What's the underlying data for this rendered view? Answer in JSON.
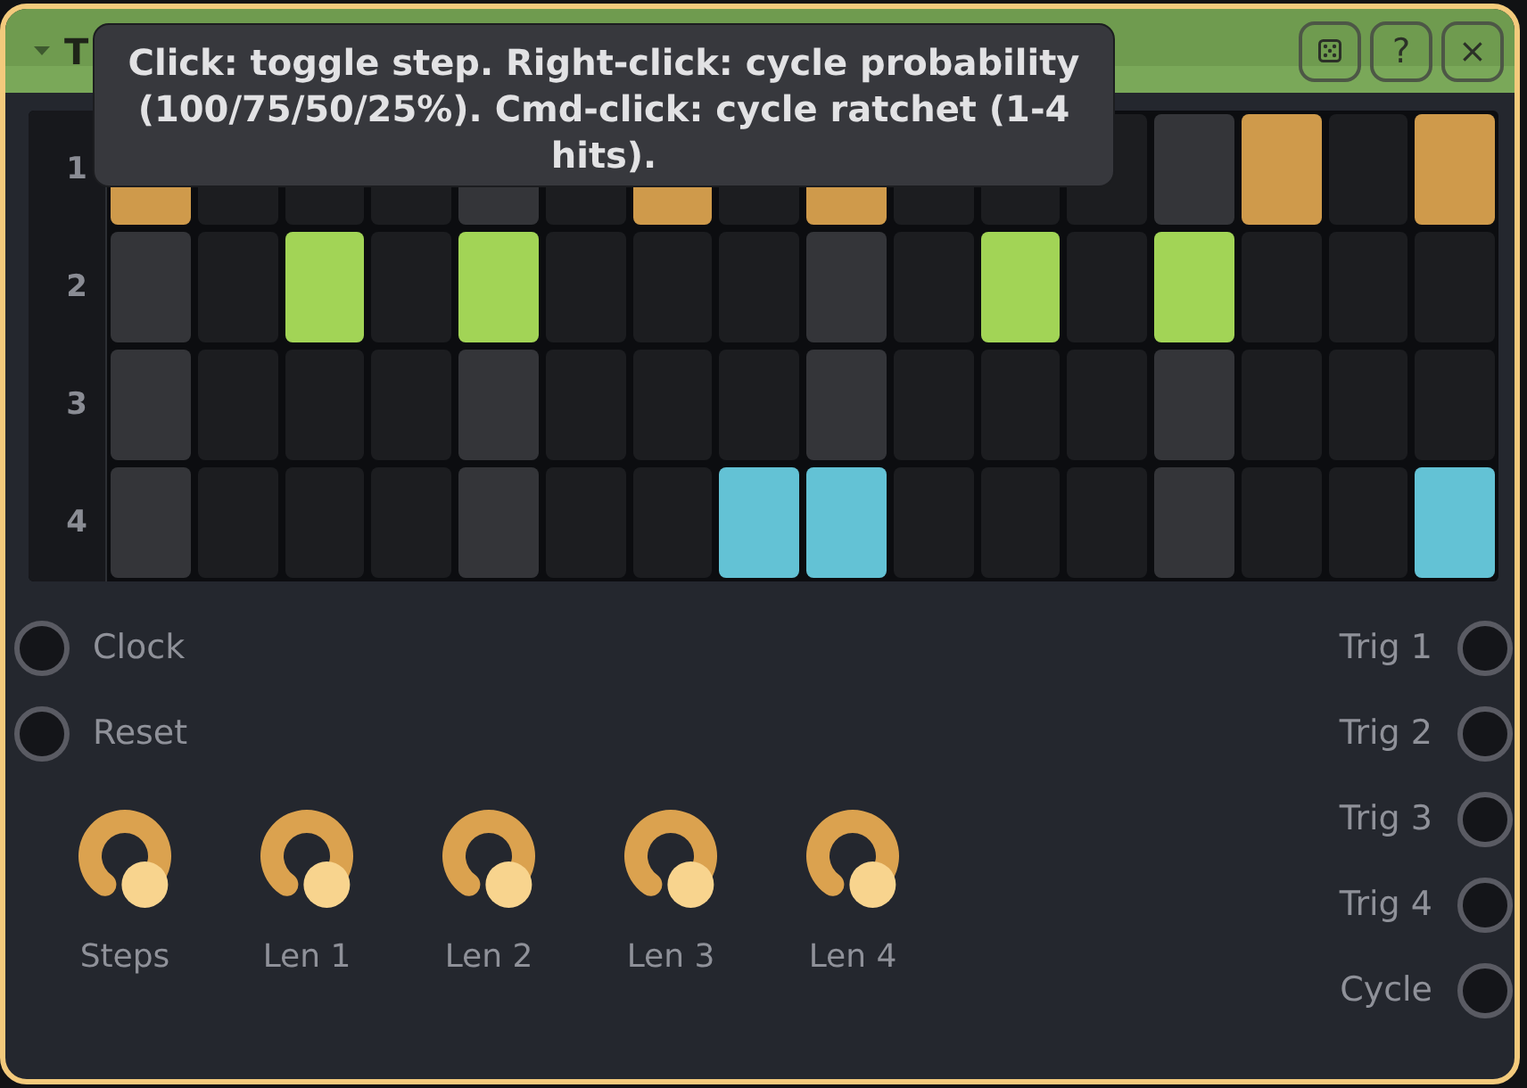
{
  "window": {
    "title": "T",
    "expanded": true,
    "buttons": [
      {
        "kind": "dice"
      },
      {
        "kind": "text",
        "label": "?"
      },
      {
        "kind": "text",
        "label": "×"
      }
    ]
  },
  "tooltip": {
    "text": "Click: toggle step. Right-click: cycle probability (100/75/50/25%). Cmd-click: cycle ratchet (1-4 hits)."
  },
  "grid": {
    "columns": [
      {
        "accent": true
      },
      {
        "accent": false
      },
      {
        "accent": false
      },
      {
        "accent": false
      },
      {
        "accent": true
      },
      {
        "accent": false
      },
      {
        "accent": false
      },
      {
        "accent": false
      },
      {
        "accent": true
      },
      {
        "accent": false
      },
      {
        "accent": false
      },
      {
        "accent": false
      },
      {
        "accent": true
      },
      {
        "accent": false
      },
      {
        "accent": false
      },
      {
        "accent": false
      }
    ],
    "rows": [
      {
        "label": "1",
        "color": "#cf9a4b",
        "steps": [
          {
            "on": true
          },
          {
            "on": false
          },
          {
            "on": false
          },
          {
            "on": false
          },
          {
            "on": false
          },
          {
            "on": false
          },
          {
            "on": true
          },
          {
            "on": false
          },
          {
            "on": true
          },
          {
            "on": false
          },
          {
            "on": false
          },
          {
            "on": false
          },
          {
            "on": false
          },
          {
            "on": true
          },
          {
            "on": false
          },
          {
            "on": true
          }
        ]
      },
      {
        "label": "2",
        "color": "#a2d456",
        "steps": [
          {
            "on": false
          },
          {
            "on": false
          },
          {
            "on": true
          },
          {
            "on": false
          },
          {
            "on": true
          },
          {
            "on": false
          },
          {
            "on": false
          },
          {
            "on": false
          },
          {
            "on": false
          },
          {
            "on": false
          },
          {
            "on": true
          },
          {
            "on": false
          },
          {
            "on": true
          },
          {
            "on": false
          },
          {
            "on": false
          },
          {
            "on": false
          }
        ]
      },
      {
        "label": "3",
        "steps": [
          {
            "on": false
          },
          {
            "on": false
          },
          {
            "on": false
          },
          {
            "on": false
          },
          {
            "on": false
          },
          {
            "on": false
          },
          {
            "on": false
          },
          {
            "on": false
          },
          {
            "on": false
          },
          {
            "on": false
          },
          {
            "on": false
          },
          {
            "on": false
          },
          {
            "on": false
          },
          {
            "on": false
          },
          {
            "on": false
          },
          {
            "on": false
          }
        ]
      },
      {
        "label": "4",
        "color": "#63c2d5",
        "steps": [
          {
            "on": false
          },
          {
            "on": false
          },
          {
            "on": false
          },
          {
            "on": false
          },
          {
            "on": false
          },
          {
            "on": false
          },
          {
            "on": false
          },
          {
            "on": true
          },
          {
            "on": true
          },
          {
            "on": false
          },
          {
            "on": false
          },
          {
            "on": false
          },
          {
            "on": false
          },
          {
            "on": false
          },
          {
            "on": false
          },
          {
            "on": true
          }
        ]
      }
    ]
  },
  "inputs": [
    {
      "label": "Clock"
    },
    {
      "label": "Reset"
    }
  ],
  "knobs": [
    {
      "label": "Steps",
      "level": 1
    },
    {
      "label": "Len 1",
      "level": 1
    },
    {
      "label": "Len 2",
      "level": 1
    },
    {
      "label": "Len 3",
      "level": 1
    },
    {
      "label": "Len 4",
      "level": 1
    }
  ],
  "outputs": [
    {
      "label": "Trig 1"
    },
    {
      "label": "Trig 2"
    },
    {
      "label": "Trig 3"
    },
    {
      "label": "Trig 4"
    },
    {
      "label": "Cycle"
    }
  ]
}
